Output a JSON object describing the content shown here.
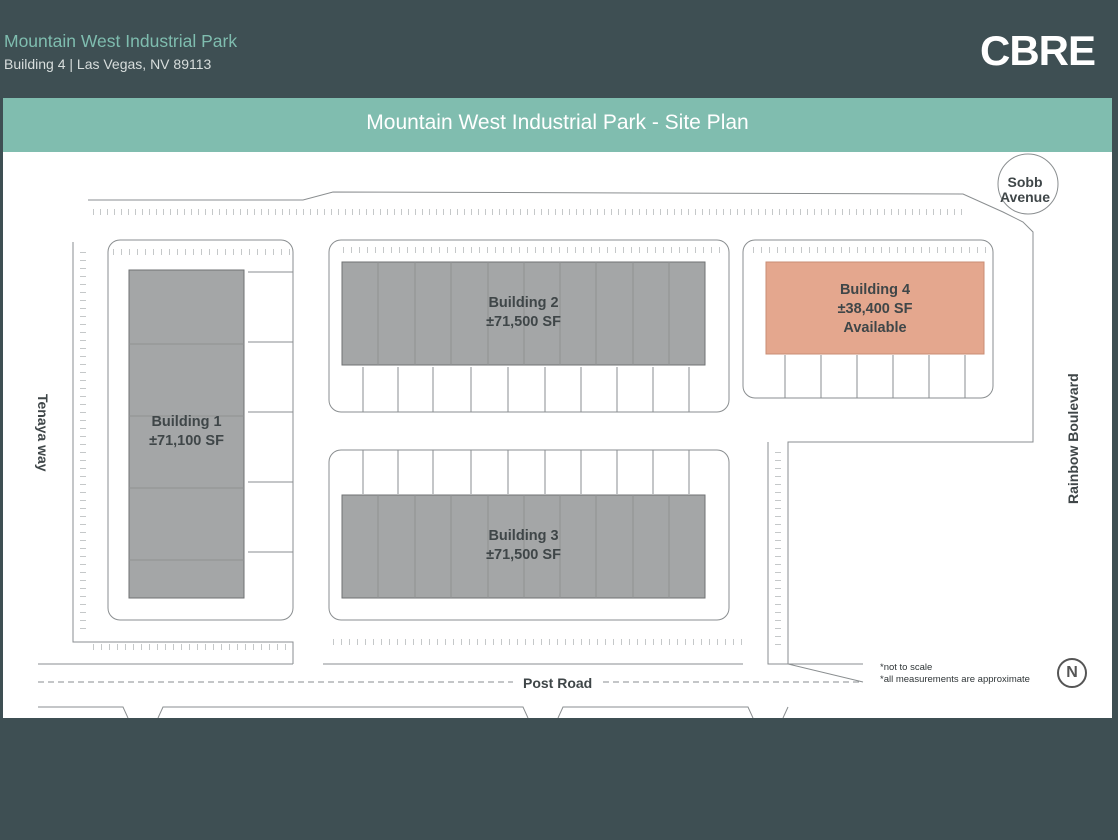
{
  "header": {
    "title": "Mountain West Industrial Park",
    "subtitle": "Building 4  |  Las Vegas, NV 89113",
    "logo": "CBRE"
  },
  "banner": {
    "title": "Mountain West Industrial Park - Site Plan"
  },
  "buildings": [
    {
      "name": "Building 1",
      "size": "±71,100 SF",
      "status": "",
      "highlight": false
    },
    {
      "name": "Building 2",
      "size": "±71,500 SF",
      "status": "",
      "highlight": false
    },
    {
      "name": "Building 3",
      "size": "±71,500 SF",
      "status": "",
      "highlight": false
    },
    {
      "name": "Building 4",
      "size": "±38,400 SF",
      "status": "Available",
      "highlight": true
    }
  ],
  "streets": {
    "west": "Tenaya way",
    "east": "Rainbow Boulevard",
    "south": "Post Road",
    "northeast_line1": "Sobb",
    "northeast_line2": "Avenue"
  },
  "notes": {
    "line1": "*not to scale",
    "line2": "*all measurements are approximate"
  },
  "north_icon": "north-arrow-icon",
  "colors": {
    "background": "#3e4f53",
    "accent": "#80bdaf",
    "building": "#a4a6a7",
    "available_building": "#e4a78e"
  }
}
